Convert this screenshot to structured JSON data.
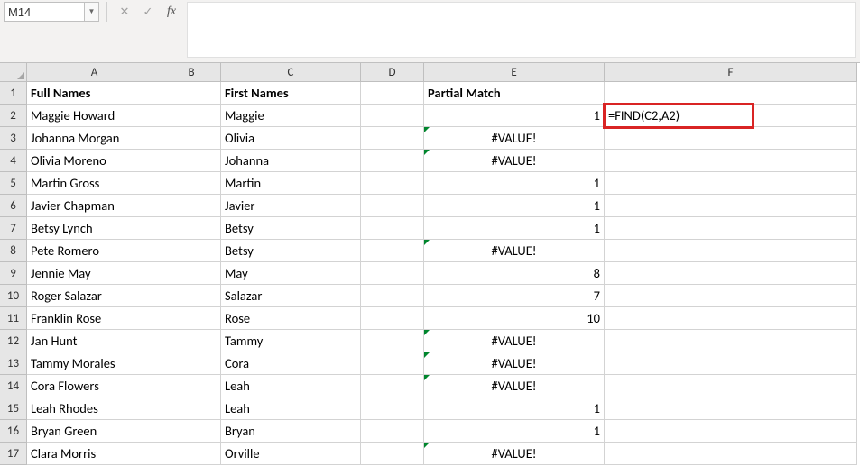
{
  "name_box": "M14",
  "fx_label": "fx",
  "columns": [
    "A",
    "B",
    "C",
    "D",
    "E",
    "F"
  ],
  "headers": {
    "A": "Full Names",
    "C": "First Names",
    "E": "Partial Match"
  },
  "formula_display": "=FIND(C2,A2)",
  "rows": [
    {
      "n": "1"
    },
    {
      "n": "2",
      "A": "Maggie Howard",
      "C": "Maggie",
      "E": "1",
      "F": "=FIND(C2,A2)",
      "Er": false
    },
    {
      "n": "3",
      "A": "Johanna Morgan",
      "C": "Olivia",
      "E": "#VALUE!",
      "Er": true
    },
    {
      "n": "4",
      "A": "Olivia Moreno",
      "C": "Johanna",
      "E": "#VALUE!",
      "Er": true
    },
    {
      "n": "5",
      "A": "Martin Gross",
      "C": "Martin",
      "E": "1",
      "Er": false
    },
    {
      "n": "6",
      "A": "Javier Chapman",
      "C": "Javier",
      "E": "1",
      "Er": false
    },
    {
      "n": "7",
      "A": "Betsy Lynch",
      "C": "Betsy",
      "E": "1",
      "Er": false
    },
    {
      "n": "8",
      "A": "Pete Romero",
      "C": "Betsy",
      "E": "#VALUE!",
      "Er": true
    },
    {
      "n": "9",
      "A": "Jennie May",
      "C": "May",
      "E": "8",
      "Er": false
    },
    {
      "n": "10",
      "A": "Roger Salazar",
      "C": "Salazar",
      "E": "7",
      "Er": false
    },
    {
      "n": "11",
      "A": "Franklin Rose",
      "C": "Rose",
      "E": "10",
      "Er": false
    },
    {
      "n": "12",
      "A": "Jan Hunt",
      "C": "Tammy",
      "E": "#VALUE!",
      "Er": true
    },
    {
      "n": "13",
      "A": "Tammy Morales",
      "C": "Cora",
      "E": "#VALUE!",
      "Er": true
    },
    {
      "n": "14",
      "A": "Cora Flowers",
      "C": "Leah",
      "E": "#VALUE!",
      "Er": true
    },
    {
      "n": "15",
      "A": "Leah Rhodes",
      "C": "Leah",
      "E": "1",
      "Er": false
    },
    {
      "n": "16",
      "A": "Bryan Green",
      "C": "Bryan",
      "E": "1",
      "Er": false
    },
    {
      "n": "17",
      "A": "Clara Morris",
      "C": "Orville",
      "E": "#VALUE!",
      "Er": true
    }
  ]
}
